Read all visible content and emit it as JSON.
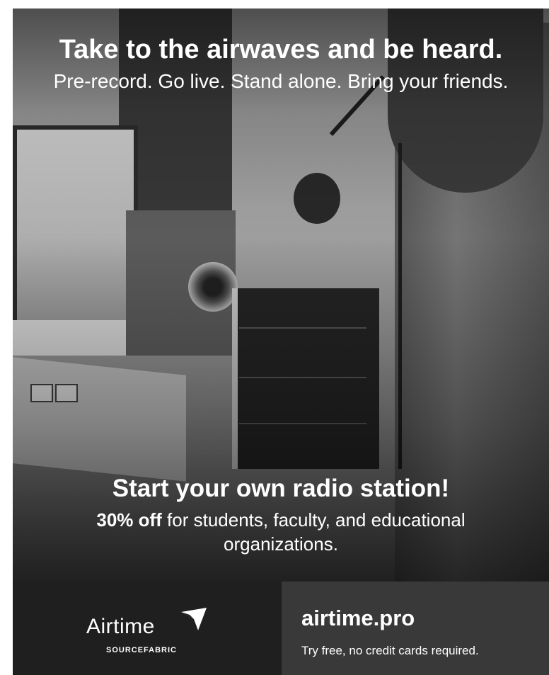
{
  "header": {
    "headline": "Take to the airwaves and be heard.",
    "subhead": "Pre-record. Go live. Stand alone. Bring your friends."
  },
  "promo": {
    "title": "Start your own radio station!",
    "discount": "30% off",
    "text": " for students, faculty, and educational organizations."
  },
  "footer": {
    "logo_word": "Airtime",
    "logo_sub": "SOURCEFABRIC",
    "site": "airtime.pro",
    "tagline": "Try free, no credit cards required."
  }
}
